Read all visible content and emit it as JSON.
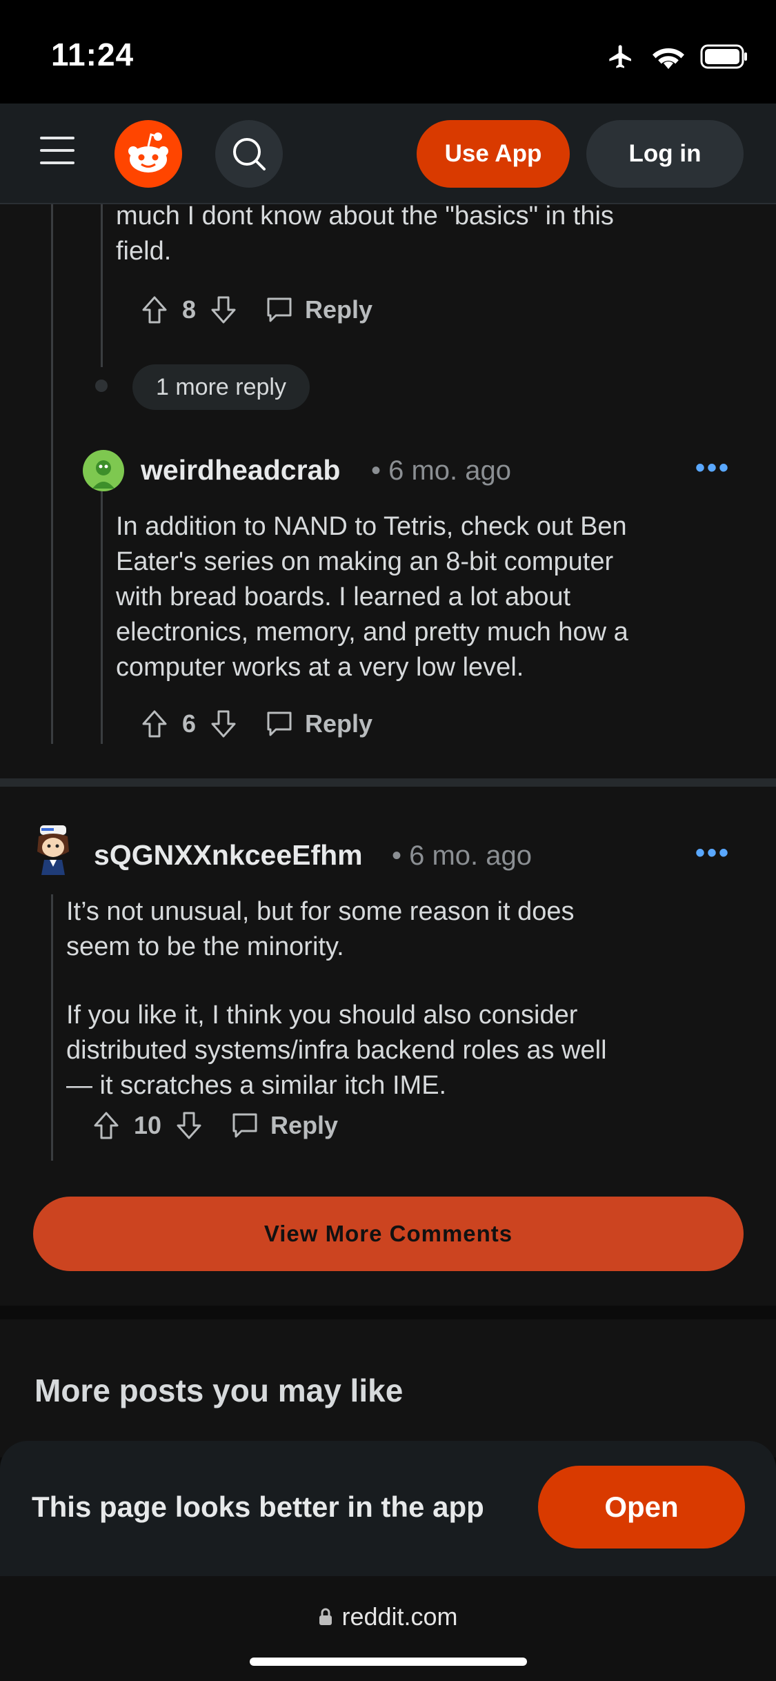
{
  "status_bar": {
    "time": "11:24"
  },
  "nav": {
    "use_app": "Use App",
    "login": "Log in"
  },
  "comment_partial": {
    "text_lines": [
      "much I dont know about the \"basics\" in this",
      "field."
    ],
    "votes": "8",
    "reply": "Reply"
  },
  "more_reply": "1 more reply",
  "comment_2": {
    "author": "weirdheadcrab",
    "time": "• 6 mo. ago",
    "text_lines": [
      "In addition to NAND to Tetris, check out Ben",
      "Eater's series on making an 8-bit computer",
      "with bread boards. I learned a lot about",
      "electronics, memory, and pretty much how a",
      "computer works at a very low level."
    ],
    "votes": "6",
    "reply": "Reply",
    "menu": "•••"
  },
  "comment_3": {
    "author": "sQGNXXnkceeEfhm",
    "time": "• 6 mo. ago",
    "text_lines": [
      "It’s not unusual, but for some reason it does",
      "seem to be the minority.",
      "",
      "If you like it, I think you should also consider",
      "distributed systems/infra backend roles as well",
      "— it scratches a similar itch IME."
    ],
    "votes": "10",
    "reply": "Reply",
    "menu": "•••"
  },
  "view_more": "View More Comments",
  "more_posts": {
    "title": "More posts you may like"
  },
  "app_banner": {
    "text": "This page looks better in the app",
    "open": "Open"
  },
  "browser": {
    "url": "reddit.com"
  },
  "colors": {
    "accent": "#d93a00",
    "link_dots": "#5aa8ff",
    "background": "#131313"
  }
}
